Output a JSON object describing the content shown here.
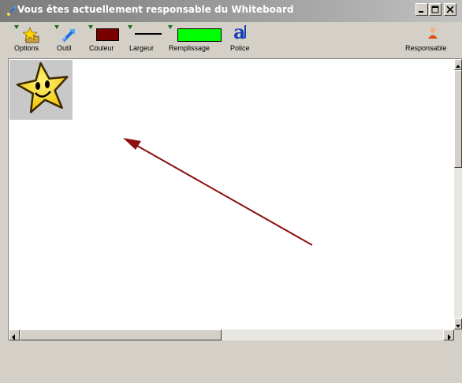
{
  "window": {
    "title": "Vous êtes actuellement responsable du Whiteboard"
  },
  "toolbar": {
    "options_label": "Options",
    "outil_label": "Outil",
    "couleur_label": "Couleur",
    "largeur_label": "Largeur",
    "remplissage_label": "Remplissage",
    "police_label": "Police",
    "police_glyph": "a",
    "responsable_label": "Responsable",
    "couleur_value": "#7a0000",
    "remplissage_value": "#00ff00"
  },
  "canvas": {
    "sticker": "star-smiley",
    "arrow_color": "#8b1010"
  }
}
